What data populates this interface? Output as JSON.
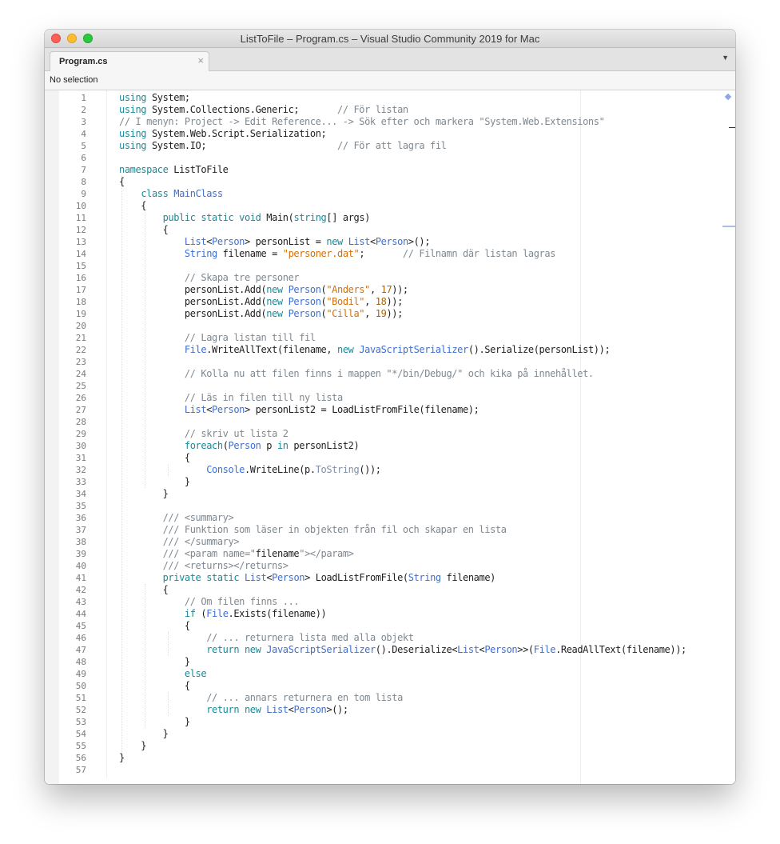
{
  "window": {
    "title": "ListToFile – Program.cs – Visual Studio Community 2019 for Mac"
  },
  "tab": {
    "label": "Program.cs",
    "close": "×",
    "menu": "▼"
  },
  "navbar": {
    "selection": "No selection"
  },
  "colors": {
    "keyword": "#1a8a99",
    "type": "#3e6fd1",
    "string": "#d2700d",
    "number": "#a8620a",
    "comment": "#7f8890"
  },
  "code": {
    "lines": [
      [
        [
          "kw",
          "using"
        ],
        [
          "tx",
          " System;"
        ]
      ],
      [
        [
          "kw",
          "using"
        ],
        [
          "tx",
          " System.Collections.Generic;       "
        ],
        [
          "com",
          "// För listan"
        ]
      ],
      [
        [
          "com",
          "// I menyn: Project -> Edit Reference... -> Sök efter och markera \"System.Web.Extensions\""
        ]
      ],
      [
        [
          "kw",
          "using"
        ],
        [
          "tx",
          " System.Web.Script.Serialization;"
        ]
      ],
      [
        [
          "kw",
          "using"
        ],
        [
          "tx",
          " System.IO;                        "
        ],
        [
          "com",
          "// För att lagra fil"
        ]
      ],
      [],
      [
        [
          "kw",
          "namespace"
        ],
        [
          "tx",
          " ListToFile"
        ]
      ],
      [
        [
          "tx",
          "{"
        ]
      ],
      [
        [
          "tx",
          "    "
        ],
        [
          "kw",
          "class"
        ],
        [
          "tx",
          " "
        ],
        [
          "type",
          "MainClass"
        ]
      ],
      [
        [
          "tx",
          "    {"
        ]
      ],
      [
        [
          "tx",
          "        "
        ],
        [
          "kw",
          "public"
        ],
        [
          "tx",
          " "
        ],
        [
          "kw",
          "static"
        ],
        [
          "tx",
          " "
        ],
        [
          "kw",
          "void"
        ],
        [
          "tx",
          " Main("
        ],
        [
          "kw",
          "string"
        ],
        [
          "tx",
          "[] args)"
        ]
      ],
      [
        [
          "tx",
          "        {"
        ]
      ],
      [
        [
          "tx",
          "            "
        ],
        [
          "type",
          "List"
        ],
        [
          "tx",
          "<"
        ],
        [
          "type",
          "Person"
        ],
        [
          "tx",
          "> personList = "
        ],
        [
          "kw",
          "new"
        ],
        [
          "tx",
          " "
        ],
        [
          "type",
          "List"
        ],
        [
          "tx",
          "<"
        ],
        [
          "type",
          "Person"
        ],
        [
          "tx",
          ">();"
        ]
      ],
      [
        [
          "tx",
          "            "
        ],
        [
          "type",
          "String"
        ],
        [
          "tx",
          " filename = "
        ],
        [
          "str",
          "\"personer.dat\""
        ],
        [
          "tx",
          ";       "
        ],
        [
          "com",
          "// Filnamn där listan lagras"
        ]
      ],
      [],
      [
        [
          "tx",
          "            "
        ],
        [
          "com",
          "// Skapa tre personer"
        ]
      ],
      [
        [
          "tx",
          "            personList.Add("
        ],
        [
          "kw",
          "new"
        ],
        [
          "tx",
          " "
        ],
        [
          "type",
          "Person"
        ],
        [
          "tx",
          "("
        ],
        [
          "str",
          "\"Anders\""
        ],
        [
          "tx",
          ", "
        ],
        [
          "num",
          "17"
        ],
        [
          "tx",
          "));"
        ]
      ],
      [
        [
          "tx",
          "            personList.Add("
        ],
        [
          "kw",
          "new"
        ],
        [
          "tx",
          " "
        ],
        [
          "type",
          "Person"
        ],
        [
          "tx",
          "("
        ],
        [
          "str",
          "\"Bodil\""
        ],
        [
          "tx",
          ", "
        ],
        [
          "num",
          "18"
        ],
        [
          "tx",
          "));"
        ]
      ],
      [
        [
          "tx",
          "            personList.Add("
        ],
        [
          "kw",
          "new"
        ],
        [
          "tx",
          " "
        ],
        [
          "type",
          "Person"
        ],
        [
          "tx",
          "("
        ],
        [
          "str",
          "\"Cilla\""
        ],
        [
          "tx",
          ", "
        ],
        [
          "num",
          "19"
        ],
        [
          "tx",
          "));"
        ]
      ],
      [],
      [
        [
          "tx",
          "            "
        ],
        [
          "com",
          "// Lagra listan till fil"
        ]
      ],
      [
        [
          "tx",
          "            "
        ],
        [
          "type",
          "File"
        ],
        [
          "tx",
          ".WriteAllText(filename, "
        ],
        [
          "kw",
          "new"
        ],
        [
          "tx",
          " "
        ],
        [
          "type",
          "JavaScriptSerializer"
        ],
        [
          "tx",
          "().Serialize(personList));"
        ]
      ],
      [],
      [
        [
          "tx",
          "            "
        ],
        [
          "com",
          "// Kolla nu att filen finns i mappen \"*/bin/Debug/\" och kika på innehållet."
        ]
      ],
      [],
      [
        [
          "tx",
          "            "
        ],
        [
          "com",
          "// Läs in filen till ny lista"
        ]
      ],
      [
        [
          "tx",
          "            "
        ],
        [
          "type",
          "List"
        ],
        [
          "tx",
          "<"
        ],
        [
          "type",
          "Person"
        ],
        [
          "tx",
          "> personList2 = LoadListFromFile(filename);"
        ]
      ],
      [],
      [
        [
          "tx",
          "            "
        ],
        [
          "com",
          "// skriv ut lista 2"
        ]
      ],
      [
        [
          "tx",
          "            "
        ],
        [
          "kw",
          "foreach"
        ],
        [
          "tx",
          "("
        ],
        [
          "type",
          "Person"
        ],
        [
          "tx",
          " p "
        ],
        [
          "kw",
          "in"
        ],
        [
          "tx",
          " personList2)"
        ]
      ],
      [
        [
          "tx",
          "            {"
        ]
      ],
      [
        [
          "tx",
          "                "
        ],
        [
          "type",
          "Console"
        ],
        [
          "tx",
          ".WriteLine(p."
        ],
        [
          "meth",
          "ToString"
        ],
        [
          "tx",
          "());"
        ]
      ],
      [
        [
          "tx",
          "            }"
        ]
      ],
      [
        [
          "tx",
          "        }"
        ]
      ],
      [],
      [
        [
          "tx",
          "        "
        ],
        [
          "com",
          "/// <summary>"
        ]
      ],
      [
        [
          "tx",
          "        "
        ],
        [
          "com",
          "/// Funktion som läser in objekten från fil och skapar en lista"
        ]
      ],
      [
        [
          "tx",
          "        "
        ],
        [
          "com",
          "/// </summary>"
        ]
      ],
      [
        [
          "tx",
          "        "
        ],
        [
          "com",
          "/// <param name=\""
        ],
        [
          "docname",
          "filename"
        ],
        [
          "com",
          "\"></param>"
        ]
      ],
      [
        [
          "tx",
          "        "
        ],
        [
          "com",
          "/// <returns></returns>"
        ]
      ],
      [
        [
          "tx",
          "        "
        ],
        [
          "kw",
          "private"
        ],
        [
          "tx",
          " "
        ],
        [
          "kw",
          "static"
        ],
        [
          "tx",
          " "
        ],
        [
          "type",
          "List"
        ],
        [
          "tx",
          "<"
        ],
        [
          "type",
          "Person"
        ],
        [
          "tx",
          "> LoadListFromFile("
        ],
        [
          "type",
          "String"
        ],
        [
          "tx",
          " filename)"
        ]
      ],
      [
        [
          "tx",
          "        {"
        ]
      ],
      [
        [
          "tx",
          "            "
        ],
        [
          "com",
          "// Om filen finns ..."
        ]
      ],
      [
        [
          "tx",
          "            "
        ],
        [
          "kw",
          "if"
        ],
        [
          "tx",
          " ("
        ],
        [
          "type",
          "File"
        ],
        [
          "tx",
          ".Exists(filename))"
        ]
      ],
      [
        [
          "tx",
          "            {"
        ]
      ],
      [
        [
          "tx",
          "                "
        ],
        [
          "com",
          "// ... returnera lista med alla objekt"
        ]
      ],
      [
        [
          "tx",
          "                "
        ],
        [
          "kw",
          "return"
        ],
        [
          "tx",
          " "
        ],
        [
          "kw",
          "new"
        ],
        [
          "tx",
          " "
        ],
        [
          "type",
          "JavaScriptSerializer"
        ],
        [
          "tx",
          "().Deserialize<"
        ],
        [
          "type",
          "List"
        ],
        [
          "tx",
          "<"
        ],
        [
          "type",
          "Person"
        ],
        [
          "tx",
          ">>("
        ],
        [
          "type",
          "File"
        ],
        [
          "tx",
          ".ReadAllText(filename));"
        ]
      ],
      [
        [
          "tx",
          "            }"
        ]
      ],
      [
        [
          "tx",
          "            "
        ],
        [
          "kw",
          "else"
        ]
      ],
      [
        [
          "tx",
          "            {"
        ]
      ],
      [
        [
          "tx",
          "                "
        ],
        [
          "com",
          "// ... annars returnera en tom lista"
        ]
      ],
      [
        [
          "tx",
          "                "
        ],
        [
          "kw",
          "return"
        ],
        [
          "tx",
          " "
        ],
        [
          "kw",
          "new"
        ],
        [
          "tx",
          " "
        ],
        [
          "type",
          "List"
        ],
        [
          "tx",
          "<"
        ],
        [
          "type",
          "Person"
        ],
        [
          "tx",
          ">();"
        ]
      ],
      [
        [
          "tx",
          "            }"
        ]
      ],
      [
        [
          "tx",
          "        }"
        ]
      ],
      [
        [
          "tx",
          "    }"
        ]
      ],
      [
        [
          "tx",
          "}"
        ]
      ],
      []
    ]
  }
}
